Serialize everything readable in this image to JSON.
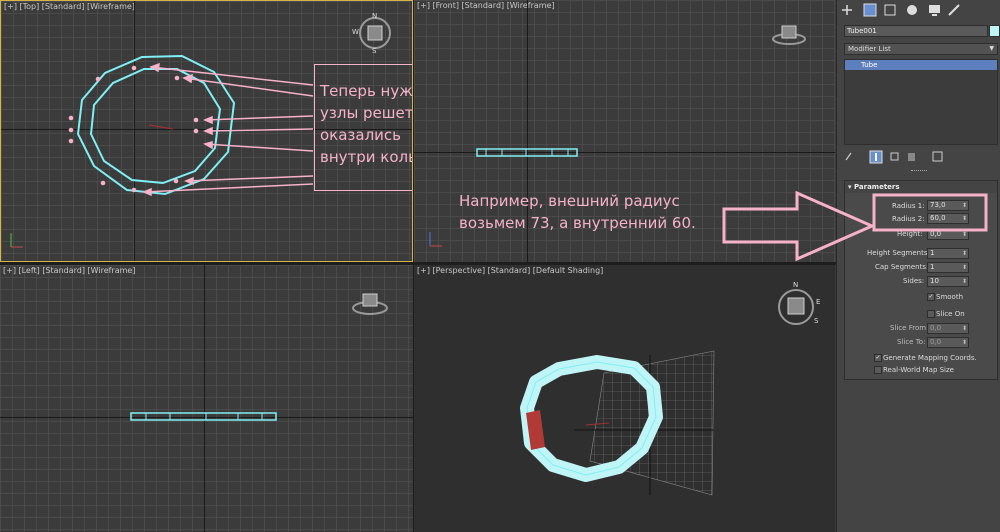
{
  "viewports": {
    "top": {
      "label": "[+] [Top] [Standard] [Wireframe]"
    },
    "front": {
      "label": "[+] [Front] [Standard] [Wireframe]"
    },
    "left": {
      "label": "[+] [Left] [Standard] [Wireframe]"
    },
    "perspective": {
      "label": "[+] [Perspective] [Standard] [Default Shading]"
    }
  },
  "compass": {
    "n": "N",
    "w": "W",
    "e": "E",
    "s": "S"
  },
  "annotations": {
    "grid_note": "Теперь нужные\nузлы решетки\nоказались\nвнутри кольца",
    "radius_note": "Например, внешний радиус\nвозьмем 73, а внутренний 60."
  },
  "command_panel": {
    "tab_icons": [
      "create-icon",
      "modify-icon",
      "hierarchy-icon",
      "motion-icon",
      "display-icon",
      "utilities-icon"
    ],
    "object_name": "Tube001",
    "object_color": "#bff5f7",
    "modifier_list_label": "Modifier List",
    "stack_items": [
      "Tube"
    ],
    "rollout_title": "Parameters",
    "params": {
      "radius1_label": "Radius 1:",
      "radius1_value": "73,0",
      "radius2_label": "Radius 2:",
      "radius2_value": "60,0",
      "height_label": "Height:",
      "height_value": "0,0",
      "height_segments_label": "Height Segments:",
      "height_segments_value": "1",
      "cap_segments_label": "Cap Segments:",
      "cap_segments_value": "1",
      "sides_label": "Sides:",
      "sides_value": "10",
      "smooth_label": "Smooth",
      "smooth_checked": true,
      "slice_on_label": "Slice On",
      "slice_on_checked": false,
      "slice_from_label": "Slice From:",
      "slice_from_value": "0,0",
      "slice_to_label": "Slice To:",
      "slice_to_value": "0,0",
      "gen_mapping_label": "Generate Mapping Coords.",
      "gen_mapping_checked": true,
      "real_world_label": "Real-World Map Size",
      "real_world_checked": false
    }
  },
  "colors": {
    "selection": "#7ff0f5",
    "annotation": "#f6b2c8",
    "viewport_active_border": "#d6b44a"
  }
}
